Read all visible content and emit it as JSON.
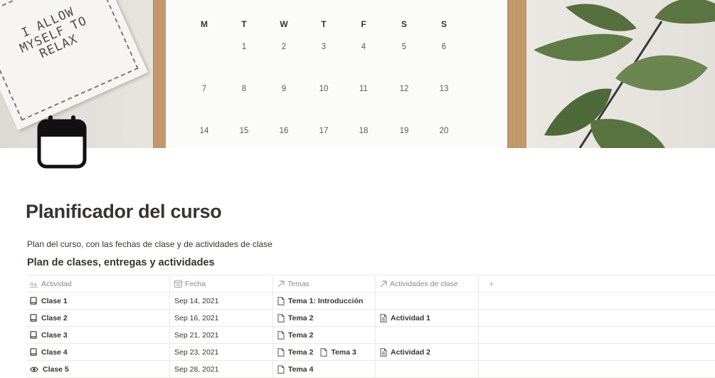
{
  "cover": {
    "calendar_days_header": [
      "M",
      "T",
      "W",
      "T",
      "F",
      "S",
      "S"
    ],
    "calendar_rows": [
      [
        "",
        "1",
        "2",
        "3",
        "4",
        "5",
        "6"
      ],
      [
        "7",
        "8",
        "9",
        "10",
        "11",
        "12",
        "13"
      ],
      [
        "14",
        "15",
        "16",
        "17",
        "18",
        "19",
        "20"
      ]
    ],
    "card_text": [
      "I ALLOW",
      "MYSELF TO",
      "RELAX"
    ]
  },
  "page": {
    "icon": "calendar-icon",
    "title": "Planificador del curso",
    "description": "Plan del curso, con las fechas de clase y de actividades de clase"
  },
  "database": {
    "title": "Plan de clases, entregas y actividades",
    "columns": [
      {
        "label": "Actividad",
        "icon": "title-property-icon"
      },
      {
        "label": "Fecha",
        "icon": "date-property-icon"
      },
      {
        "label": "Temas",
        "icon": "relation-arrow-icon"
      },
      {
        "label": "Actividades de clase",
        "icon": "relation-arrow-icon"
      }
    ],
    "add_column_label": "+",
    "rows": [
      {
        "name": "Clase 1",
        "icon": "book-icon",
        "date": "Sep 14, 2021",
        "temas": [
          "Tema 1: Introducción"
        ],
        "actividades": []
      },
      {
        "name": "Clase 2",
        "icon": "book-icon",
        "date": "Sep 16, 2021",
        "temas": [
          "Tema 2"
        ],
        "actividades": [
          "Actividad 1"
        ]
      },
      {
        "name": "Clase 3",
        "icon": "book-icon",
        "date": "Sep 21, 2021",
        "temas": [
          "Tema 2"
        ],
        "actividades": []
      },
      {
        "name": "Clase 4",
        "icon": "book-icon",
        "date": "Sep 23, 2021",
        "temas": [
          "Tema 2",
          "Tema 3"
        ],
        "actividades": [
          "Actividad 2"
        ]
      },
      {
        "name": "Clase 5",
        "icon": "eye-icon",
        "date": "Sep 28, 2021",
        "temas": [
          "Tema 4"
        ],
        "actividades": []
      }
    ]
  },
  "colors": {
    "text": "#37352f",
    "muted": "#8a8985",
    "border": "#e9e9e7",
    "board": "#c49a6c",
    "leaf": "#5e7a45"
  }
}
